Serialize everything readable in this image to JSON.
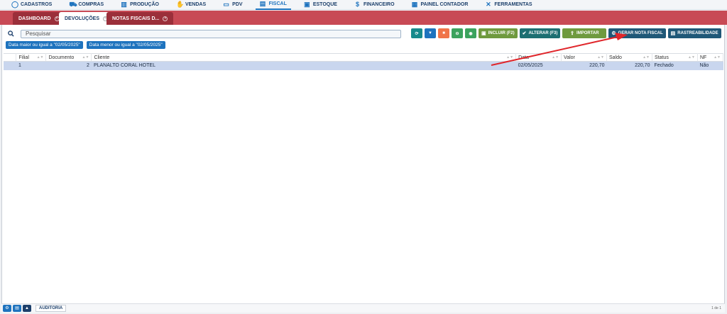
{
  "menu": [
    {
      "label": "CADASTROS",
      "icon": "circle-icon",
      "glyph": "◯"
    },
    {
      "label": "COMPRAS",
      "icon": "cart-icon",
      "glyph": "⛟"
    },
    {
      "label": "PRODUÇÃO",
      "icon": "factory-icon",
      "glyph": "▥"
    },
    {
      "label": "VENDAS",
      "icon": "handshake-icon",
      "glyph": "✋"
    },
    {
      "label": "PDV",
      "icon": "monitor-icon",
      "glyph": "▭"
    },
    {
      "label": "FISCAL",
      "icon": "ledger-icon",
      "glyph": "▤"
    },
    {
      "label": "ESTOQUE",
      "icon": "box-icon",
      "glyph": "▣"
    },
    {
      "label": "FINANCEIRO",
      "icon": "dollar-icon",
      "glyph": "$"
    },
    {
      "label": "PAINEL CONTADOR",
      "icon": "calendar-icon",
      "glyph": "▦"
    },
    {
      "label": "FERRAMENTAS",
      "icon": "tools-icon",
      "glyph": "✕"
    }
  ],
  "active_menu": "FISCAL",
  "tabs": [
    {
      "label": "DASHBOARD"
    },
    {
      "label": "DEVOLUÇÕES"
    },
    {
      "label": "NOTAS FISCAIS D..."
    }
  ],
  "search": {
    "placeholder": "Pesquisar"
  },
  "filters": [
    "Data maior ou igual a \"02/05/2025\"",
    "Data menor ou igual a \"02/05/2025\""
  ],
  "toolbar": {
    "incluir": "INCLUIR (F2)",
    "alterar": "ALTERAR (F3)",
    "importar": "IMPORTAR",
    "gerar": "GERAR NOTA FISCAL",
    "rastreabilidade": "RASTREABILIDADE"
  },
  "table": {
    "columns": [
      "Filial",
      "Documento",
      "Cliente",
      "Data",
      "Valor",
      "Saldo",
      "Status",
      "NF"
    ],
    "rows": [
      {
        "filial": "1",
        "documento": "2",
        "cliente": "PLANALTO CORAL HOTEL",
        "data": "02/05/2025",
        "valor": "220,70",
        "saldo": "220,70",
        "status": "Fechado",
        "nf": "Não"
      }
    ]
  },
  "footer": {
    "tab": "AUDITORIA",
    "pager": "1 de 1"
  },
  "colors": {
    "accent": "#1e73be",
    "band": "#c84a55",
    "selected_row": "#c9d6ee",
    "arrow": "#e0262b"
  }
}
